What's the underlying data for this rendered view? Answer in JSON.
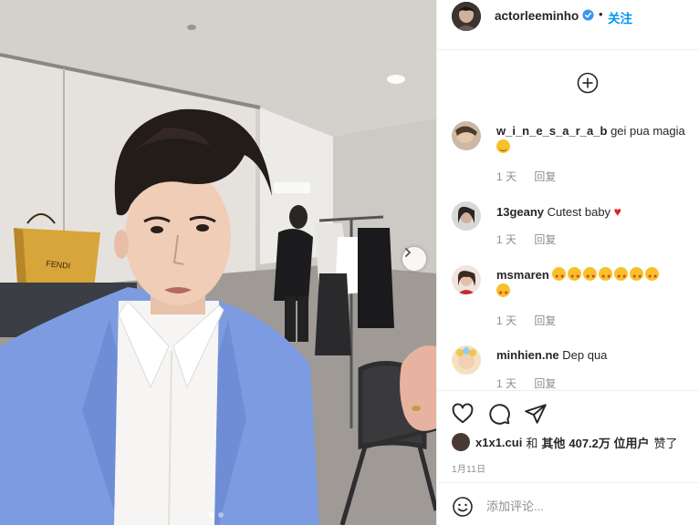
{
  "post": {
    "author": "actorleeminho",
    "verified": true,
    "separator": "•",
    "follow_label": "关注"
  },
  "photo": {
    "carousel_count": 2,
    "carousel_active": 0,
    "bag_brand": "FENDI"
  },
  "comments": [
    {
      "username": "w_i_n_e_s_a_r_a_b",
      "text": "gei pua magia",
      "emoji": [
        "smile"
      ],
      "age": "1 天",
      "reply_label": "回复"
    },
    {
      "username": "13geany",
      "text": "Cutest baby",
      "emoji": [
        "heart"
      ],
      "age": "1 天",
      "reply_label": "回复"
    },
    {
      "username": "msmaren",
      "text": "",
      "emoji": [
        "star-eyes",
        "star-eyes",
        "star-eyes",
        "star-eyes",
        "star-eyes",
        "star-eyes",
        "star-eyes",
        "star-eyes"
      ],
      "age": "1 天",
      "reply_label": "回复"
    },
    {
      "username": "minhien.ne",
      "text": "Dep qua",
      "emoji": [],
      "age": "1 天",
      "reply_label": "回复"
    }
  ],
  "likes": {
    "first_liker": "x1x1.cui",
    "and_label": "和",
    "others_label": "其他",
    "count_label": "407.2万 位用户",
    "liked_label": "赞了"
  },
  "date": "1月11日",
  "add_comment": {
    "placeholder": "添加评论..."
  },
  "icons": {
    "like": "heart-icon",
    "comment": "comment-icon",
    "share": "paper-plane-icon",
    "emoji": "smile-icon",
    "load_more": "plus-circle-icon",
    "next": "chevron-right-icon"
  },
  "colors": {
    "accent": "#0095f6",
    "text": "#262626",
    "muted": "#8e8e8e",
    "jacket": "#7d9be0"
  }
}
